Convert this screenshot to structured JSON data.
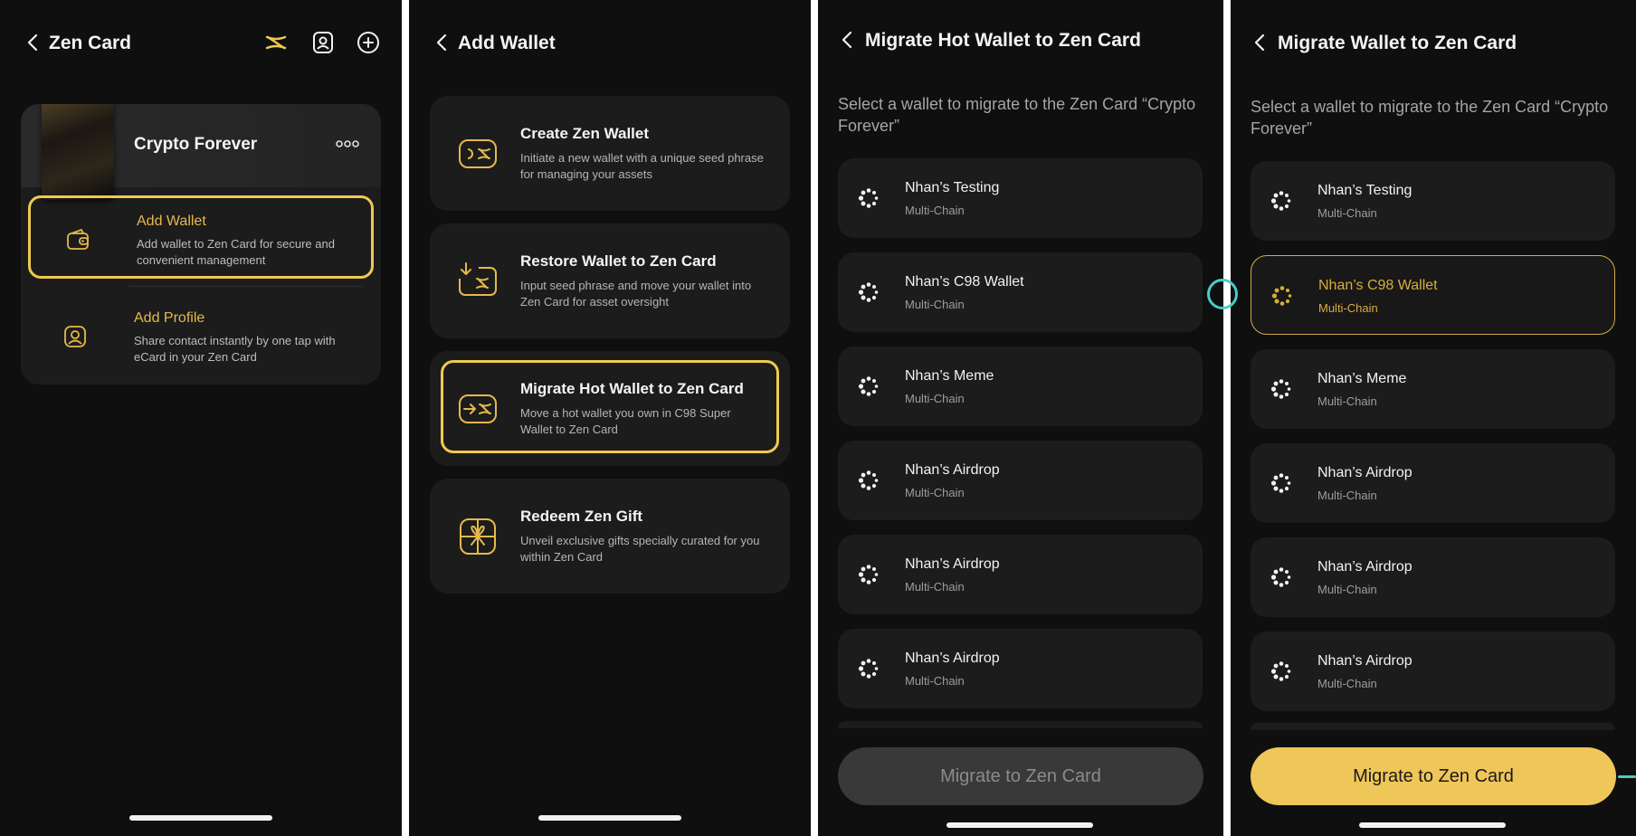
{
  "colors": {
    "background": "#0f0f0f",
    "panel": "#1c1c1c",
    "accent": "#f0c94f",
    "accent_text": "#e7b84a",
    "teal": "#48cdc4"
  },
  "screen1": {
    "title": "Zen Card",
    "header_icons": [
      "zen-logo-icon",
      "profile-card-icon",
      "add-circle-icon"
    ],
    "card": {
      "name": "Crypto Forever",
      "menu_icon": "more-dots-icon"
    },
    "options": [
      {
        "label": "Add Wallet",
        "desc": "Add wallet to Zen Card for secure and convenient management",
        "icon": "wallet-icon"
      },
      {
        "label": "Add Profile",
        "desc": "Share contact instantly by one tap with eCard in your Zen Card",
        "icon": "profile-icon"
      }
    ]
  },
  "screen2": {
    "title": "Add Wallet",
    "options": [
      {
        "label": "Create Zen Wallet",
        "desc": "Initiate a new wallet with a unique seed phrase for managing your assets",
        "icon": "create-wallet-icon"
      },
      {
        "label": "Restore Wallet to Zen Card",
        "desc": "Input seed phrase and move your wallet into Zen Card for asset oversight",
        "icon": "restore-wallet-icon"
      },
      {
        "label": "Migrate Hot Wallet to Zen Card",
        "desc": "Move a hot wallet you own in C98 Super Wallet to Zen Card",
        "icon": "migrate-wallet-icon"
      },
      {
        "label": "Redeem Zen Gift",
        "desc": "Unveil exclusive gifts specially curated for you within Zen Card",
        "icon": "gift-icon"
      }
    ]
  },
  "screen3": {
    "title": "Migrate Hot Wallet to Zen Card",
    "subtitle": "Select a wallet to migrate to the Zen Card “Crypto Forever”",
    "wallets": [
      {
        "name": "Nhan’s Testing",
        "type": "Multi-Chain"
      },
      {
        "name": "Nhan’s C98 Wallet",
        "type": "Multi-Chain"
      },
      {
        "name": "Nhan’s Meme",
        "type": "Multi-Chain"
      },
      {
        "name": "Nhan’s Airdrop",
        "type": "Multi-Chain"
      },
      {
        "name": "Nhan’s Airdrop",
        "type": "Multi-Chain"
      },
      {
        "name": "Nhan’s Airdrop",
        "type": "Multi-Chain"
      }
    ],
    "button": "Migrate to Zen Card"
  },
  "screen4": {
    "title": "Migrate Wallet to Zen Card",
    "subtitle": "Select a wallet to migrate to the Zen Card “Crypto Forever”",
    "wallets": [
      {
        "name": "Nhan’s Testing",
        "type": "Multi-Chain"
      },
      {
        "name": "Nhan’s C98 Wallet",
        "type": "Multi-Chain"
      },
      {
        "name": "Nhan’s Meme",
        "type": "Multi-Chain"
      },
      {
        "name": "Nhan’s Airdrop",
        "type": "Multi-Chain"
      },
      {
        "name": "Nhan’s Airdrop",
        "type": "Multi-Chain"
      },
      {
        "name": "Nhan’s Airdrop",
        "type": "Multi-Chain"
      }
    ],
    "selected_index": 1,
    "button": "Migrate to Zen Card"
  }
}
